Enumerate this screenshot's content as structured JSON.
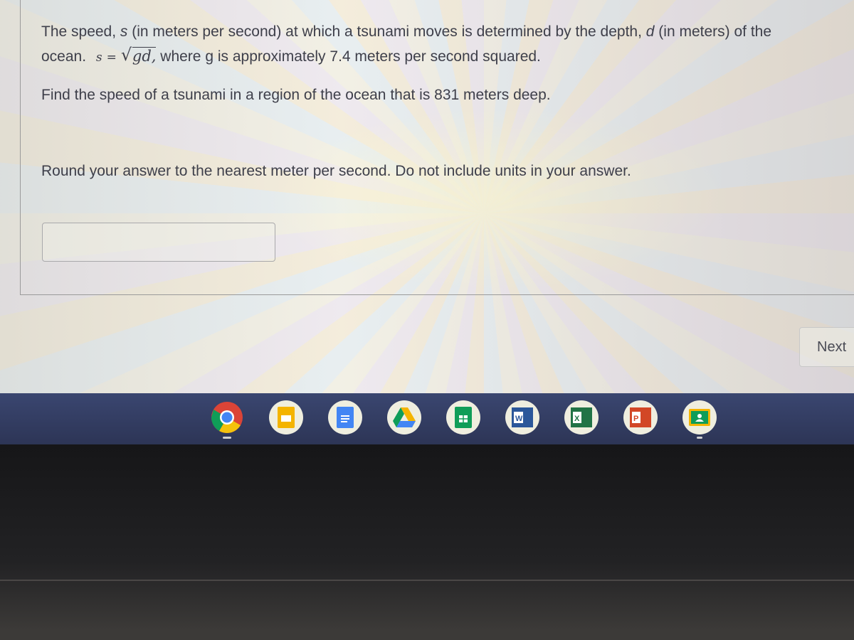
{
  "question": {
    "line1": {
      "prefix": "The speed, ",
      "var_s": "s",
      "middle": " (in meters per second) at which a tsunami moves is determined by the depth, ",
      "var_d": "d",
      "suffix": " (in meters) of the"
    },
    "line2": {
      "prefix": "ocean.",
      "formula_lhs": "s",
      "formula_eq": "=",
      "formula_radicand": "gd,",
      "suffix": " where g is approximately 7.4 meters per second squared."
    },
    "line3": "Find the speed of a tsunami in a region of the ocean that is 831 meters deep.",
    "line4": "Round your answer to the nearest meter per second.  Do not include units in your answer."
  },
  "answer_input": {
    "value": "",
    "placeholder": ""
  },
  "next_button": {
    "label": "Next"
  },
  "shelf": {
    "apps": [
      {
        "name": "chrome",
        "icon": "chrome-icon",
        "active": true
      },
      {
        "name": "google-slides",
        "icon": "slides-icon"
      },
      {
        "name": "google-docs",
        "icon": "docs-icon"
      },
      {
        "name": "google-drive",
        "icon": "drive-icon"
      },
      {
        "name": "google-sheets",
        "icon": "sheets-icon"
      },
      {
        "name": "microsoft-word",
        "icon": "word-icon",
        "letter": "W"
      },
      {
        "name": "microsoft-excel",
        "icon": "excel-icon",
        "letter": "X"
      },
      {
        "name": "microsoft-powerpoint",
        "icon": "powerpoint-icon",
        "letter": "P"
      },
      {
        "name": "google-classroom",
        "icon": "classroom-icon",
        "active": true
      }
    ]
  }
}
